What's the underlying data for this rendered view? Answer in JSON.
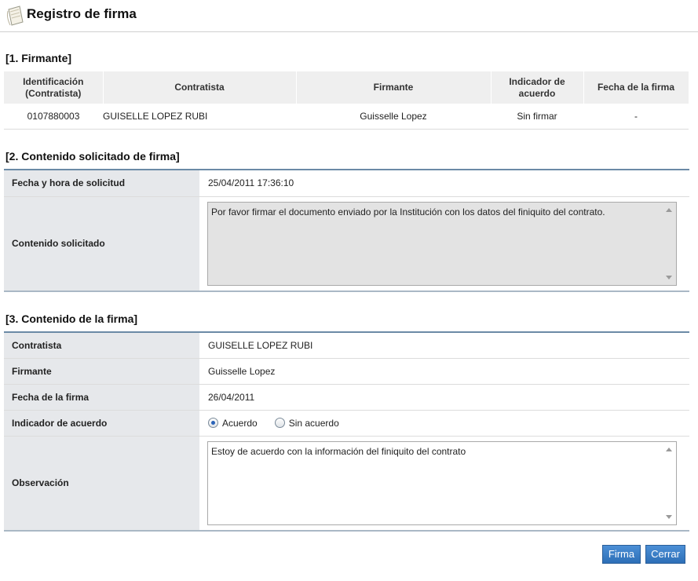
{
  "header": {
    "title": "Registro de firma"
  },
  "section1": {
    "title": "[1. Firmante]",
    "columns": [
      "Identificación\n(Contratista)",
      "Contratista",
      "Firmante",
      "Indicador de\nacuerdo",
      "Fecha de la firma"
    ],
    "rows": [
      [
        "0107880003",
        "GUISELLE LOPEZ RUBI",
        "Guisselle Lopez",
        "Sin firmar",
        "-"
      ]
    ]
  },
  "section2": {
    "title": "[2. Contenido solicitado de firma]",
    "fecha_label": "Fecha y hora de solicitud",
    "fecha_value": "25/04/2011 17:36:10",
    "contenido_label": "Contenido solicitado",
    "contenido_value": "Por favor firmar el documento enviado por la Institución con los datos del finiquito del contrato."
  },
  "section3": {
    "title": "[3. Contenido de la firma]",
    "contratista_label": "Contratista",
    "contratista_value": "GUISELLE LOPEZ RUBI",
    "firmante_label": "Firmante",
    "firmante_value": "Guisselle Lopez",
    "fecha_label": "Fecha de la firma",
    "fecha_value": "26/04/2011",
    "indicador_label": "Indicador de acuerdo",
    "radio_acuerdo": "Acuerdo",
    "radio_sin_acuerdo": "Sin acuerdo",
    "selected": "Acuerdo",
    "observacion_label": "Observación",
    "observacion_value": "Estoy de acuerdo con la información del finiquito del contrato"
  },
  "buttons": {
    "firma": "Firma",
    "cerrar": "Cerrar"
  }
}
